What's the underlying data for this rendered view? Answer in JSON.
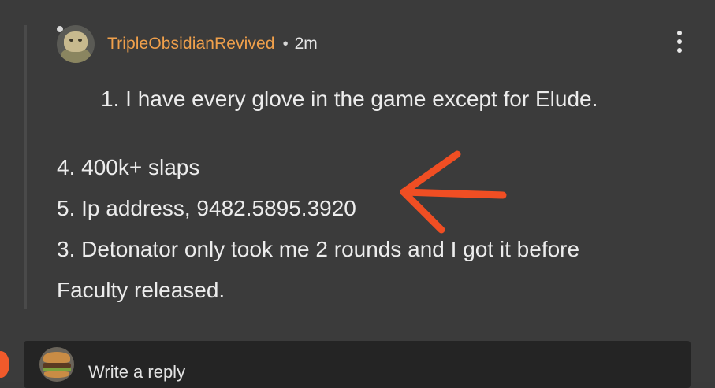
{
  "comment": {
    "username": "TripleObsidianRevived",
    "separator": "•",
    "timestamp": "2m",
    "menu_icon": "more-vertical-icon",
    "lines": [
      "1.  I have every glove in the game except for Elude.",
      "4. 400k+ slaps",
      "5. Ip address, 9482.5895.3920",
      "3. Detonator only took me 2 rounds and I got it before",
      "Faculty released."
    ]
  },
  "annotation": {
    "icon": "hand-drawn-arrow-icon",
    "color": "#f04e23"
  },
  "reply": {
    "placeholder": "Write a reply"
  },
  "colors": {
    "background": "#3b3b3b",
    "username": "#f0a04b",
    "text": "#ececec",
    "reply_bar": "#242424"
  }
}
